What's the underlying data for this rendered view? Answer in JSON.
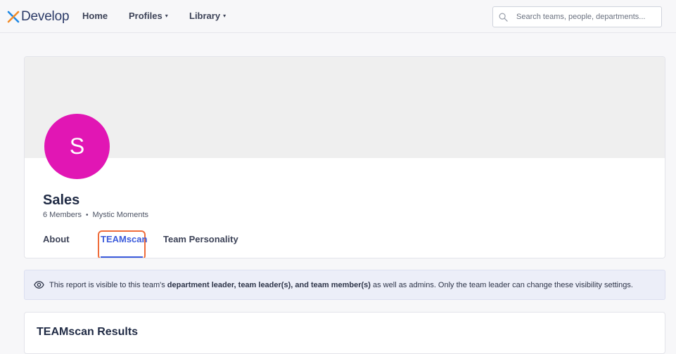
{
  "app": {
    "logo_text": "Develop",
    "accent_color": "#3b5bdb",
    "logo_colors": [
      "#f28c28",
      "#1e88e5"
    ]
  },
  "nav": {
    "home": "Home",
    "profiles": "Profiles",
    "library": "Library",
    "caret": "▾"
  },
  "search": {
    "placeholder": "Search teams, people, departments...",
    "value": ""
  },
  "team": {
    "avatar_letter": "S",
    "avatar_color": "#e116b4",
    "name": "Sales",
    "members": "6 Members",
    "separator": "•",
    "department": "Mystic Moments"
  },
  "tabs": [
    {
      "label": "About",
      "active": false
    },
    {
      "label": "TEAMscan",
      "active": true
    },
    {
      "label": "Team Personality",
      "active": false
    }
  ],
  "notice": {
    "icon": "eye-icon",
    "prefix": "This report is visible to this team's ",
    "bold": "department leader, team leader(s), and team member(s)",
    "suffix": " as well as admins. Only the team leader can change these visibility settings."
  },
  "results": {
    "title": "TEAMscan Results"
  }
}
